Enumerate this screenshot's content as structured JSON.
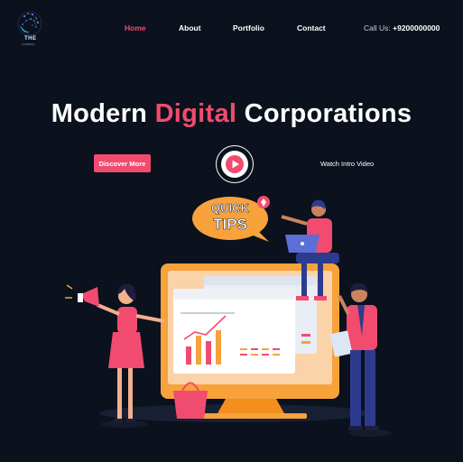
{
  "brand": {
    "logo_text": "THE",
    "logo_sub": "company"
  },
  "nav": {
    "items": [
      "Home",
      "About",
      "Portfolio",
      "Contact"
    ],
    "active": "Home"
  },
  "contact": {
    "label": "Call Us:",
    "phone": "+9200000000"
  },
  "hero": {
    "title_part1": "Modern ",
    "title_accent": "Digital",
    "title_part2": " Corporations",
    "cta_label": "Discover More",
    "video_label": "Watch Intro Video"
  },
  "illustration": {
    "badge_line1": "QUICK",
    "badge_line2": "TIPS"
  },
  "colors": {
    "background": "#0b111d",
    "accent": "#f14b6f",
    "orange": "#f7a23b"
  }
}
